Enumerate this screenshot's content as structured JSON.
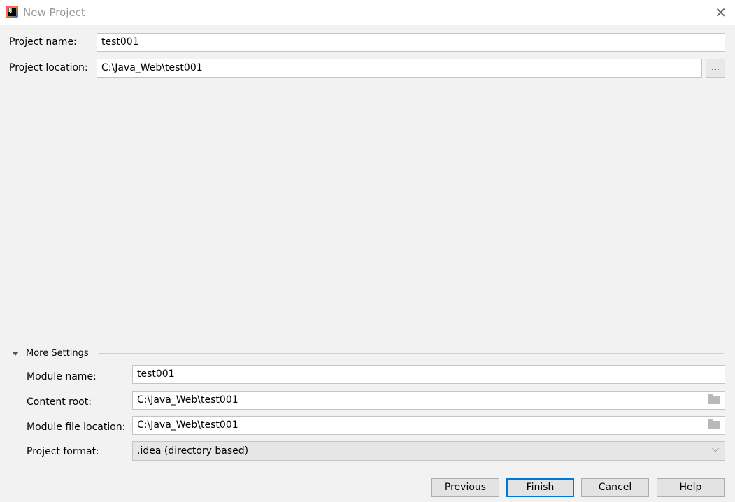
{
  "window": {
    "title": "New Project",
    "close_icon": "close-icon",
    "app_icon": "intellij-idea-icon",
    "app_icon_text": "IJ"
  },
  "project": {
    "name_label": "Project name:",
    "name_value": "test001",
    "location_label": "Project location:",
    "location_value": "C:\\Java_Web\\test001",
    "browse_label": "..."
  },
  "more_settings": {
    "title": "More Settings",
    "expanded": true,
    "module_name_label": "Module name:",
    "module_name_value": "test001",
    "content_root_label": "Content root:",
    "content_root_value": "C:\\Java_Web\\test001",
    "module_file_label": "Module file location:",
    "module_file_value": "C:\\Java_Web\\test001",
    "format_label": "Project format:",
    "format_value": ".idea (directory based)"
  },
  "buttons": {
    "previous": "Previous",
    "finish": "Finish",
    "cancel": "Cancel",
    "help": "Help"
  }
}
